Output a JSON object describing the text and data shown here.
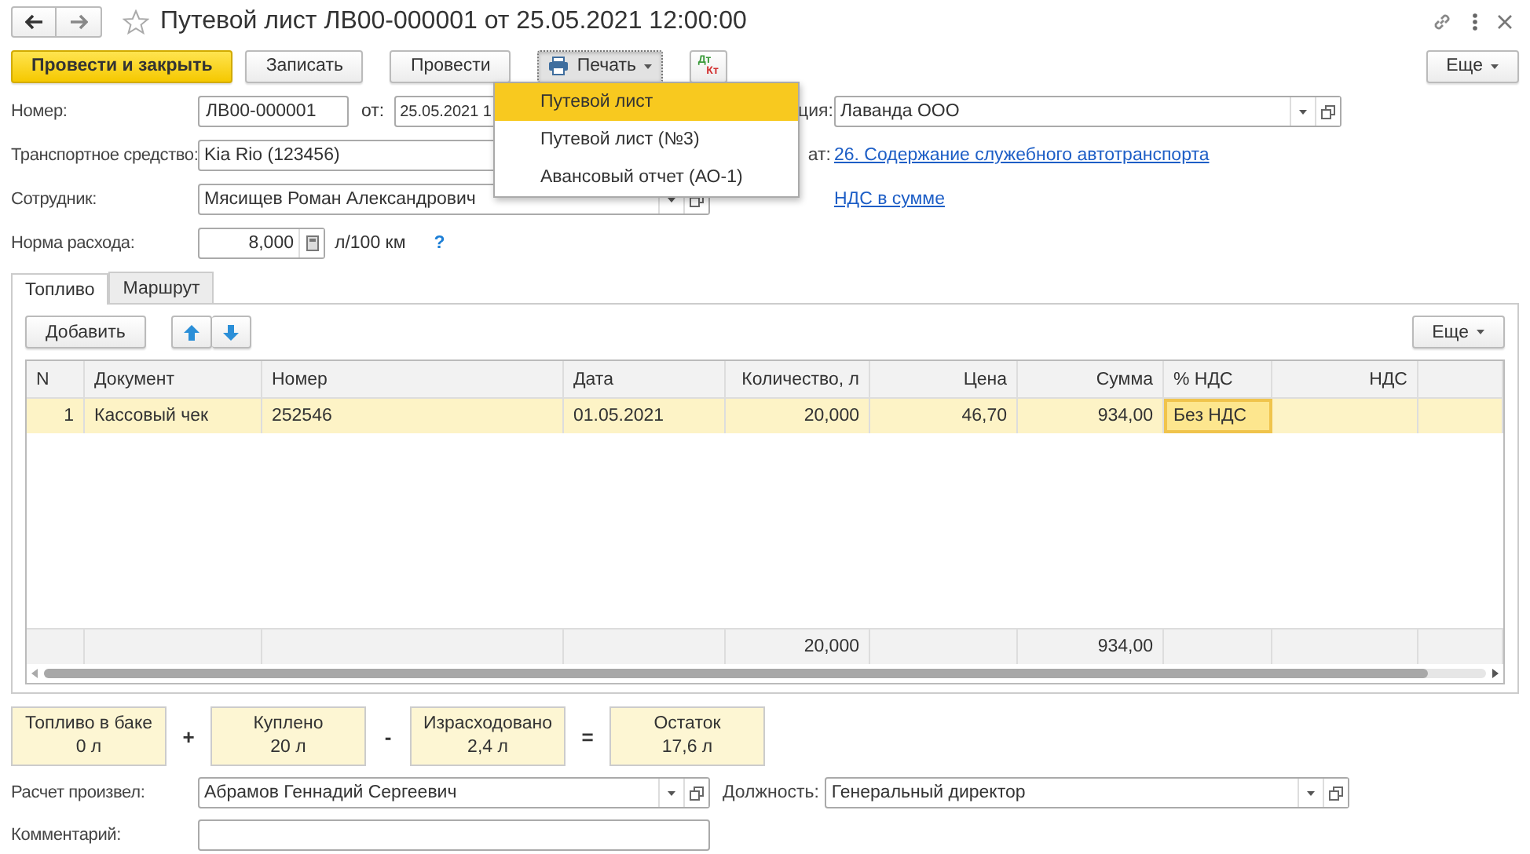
{
  "window": {
    "title": "Путевой лист ЛВ00-000001 от 25.05.2021 12:00:00",
    "favorite": false
  },
  "toolbar": {
    "buttons": [
      {
        "kind": "default",
        "label": "Провести и закрыть"
      },
      {
        "kind": "plain",
        "label": "Записать"
      },
      {
        "kind": "plain",
        "label": "Провести"
      },
      {
        "kind": "menu",
        "label": "Печать",
        "pressed": true
      },
      {
        "kind": "accounting",
        "top": "Дт",
        "bottom": "Кт"
      }
    ],
    "more": "Еще"
  },
  "print_menu": {
    "items": [
      {
        "label": "Путевой лист",
        "selected": true
      },
      {
        "label": "Путевой лист (№3)",
        "selected": false
      },
      {
        "label": "Авансовый отчет (АО-1)",
        "selected": false
      }
    ]
  },
  "form": {
    "number": {
      "label": "Номер:",
      "value": "ЛВ00-000001"
    },
    "date": {
      "label": "от:",
      "value": "25.05.2021 1"
    },
    "organization": {
      "label": "ция:",
      "value": "Лаванда ООО"
    },
    "vehicle": {
      "label": "Транспортное средство:",
      "value": "Kia Rio (123456)"
    },
    "cost_account": {
      "label": "ат:",
      "link": "26. Содержание служебного автотранспорта"
    },
    "employee": {
      "label": "Сотрудник:",
      "value": "Мясищев Роман Александрович"
    },
    "vat_mode": {
      "link": "НДС в сумме"
    },
    "consumption_rate": {
      "label": "Норма расхода:",
      "value": "8,000",
      "unit": "л/100 км",
      "help": "?"
    }
  },
  "tabs": [
    {
      "label": "Топливо",
      "selected": true
    },
    {
      "label": "Маршрут",
      "selected": false
    }
  ],
  "fuel_table": {
    "add": "Добавить",
    "more": "Еще",
    "columns": [
      "N",
      "Документ",
      "Номер",
      "Дата",
      "Количество, л",
      "Цена",
      "Сумма",
      "% НДС",
      "НДС"
    ],
    "rows": [
      {
        "selected": true,
        "cells": [
          {
            "text": "1",
            "focused": false
          },
          {
            "text": "Кассовый чек",
            "focused": false
          },
          {
            "text": "252546",
            "focused": false
          },
          {
            "text": "01.05.2021",
            "focused": false
          },
          {
            "text": "20,000",
            "focused": false
          },
          {
            "text": "46,70",
            "focused": false
          },
          {
            "text": "934,00",
            "focused": false
          },
          {
            "text": "Без НДС",
            "focused": true
          },
          {
            "focused": false
          }
        ]
      }
    ],
    "totals": {
      "quantity": "20,000",
      "amount": "934,00"
    }
  },
  "fuel_balance": [
    {
      "kind": "box",
      "label": "Топливо в баке",
      "value": "0 л"
    },
    {
      "kind": "operator",
      "text": "+"
    },
    {
      "kind": "box",
      "label": "Куплено",
      "value": "20 л"
    },
    {
      "kind": "operator",
      "text": "-"
    },
    {
      "kind": "box",
      "label": "Израсходовано",
      "value": "2,4 л"
    },
    {
      "kind": "operator",
      "text": "="
    },
    {
      "kind": "box",
      "label": "Остаток",
      "value": "17,6 л"
    }
  ],
  "calculated_by": {
    "label": "Расчет произвел:",
    "value": "Абрамов Геннадий Сергеевич"
  },
  "position": {
    "label": "Должность:",
    "value": "Генеральный директор"
  },
  "comment": {
    "label": "Комментарий:"
  }
}
